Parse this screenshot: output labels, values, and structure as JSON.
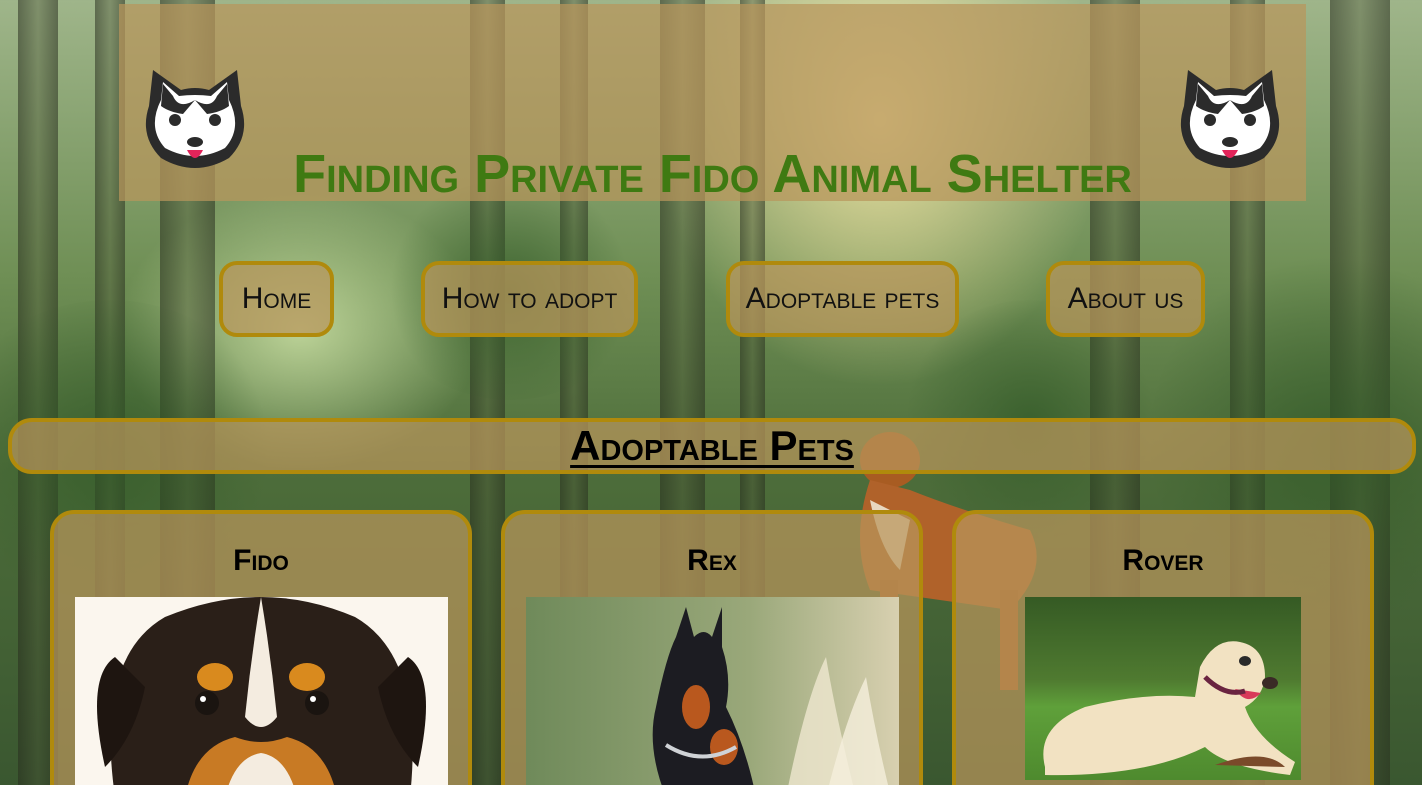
{
  "header": {
    "title": "Finding Private Fido Animal Shelter",
    "logo_icon": "dog-face-icon"
  },
  "nav": {
    "items": [
      {
        "label": "Home"
      },
      {
        "label": "How to adopt"
      },
      {
        "label": "Adoptable pets"
      },
      {
        "label": "About us"
      }
    ]
  },
  "main": {
    "section_title": "Adoptable Pets",
    "pets": [
      {
        "name": "Fido",
        "photo": "puppy-photo"
      },
      {
        "name": "Rex",
        "photo": "doberman-photo"
      },
      {
        "name": "Rover",
        "photo": "labrador-photo"
      }
    ]
  },
  "colors": {
    "title_green": "#3f7a12",
    "border_gold": "#b08a0c",
    "panel_tan": "#b8965c"
  }
}
